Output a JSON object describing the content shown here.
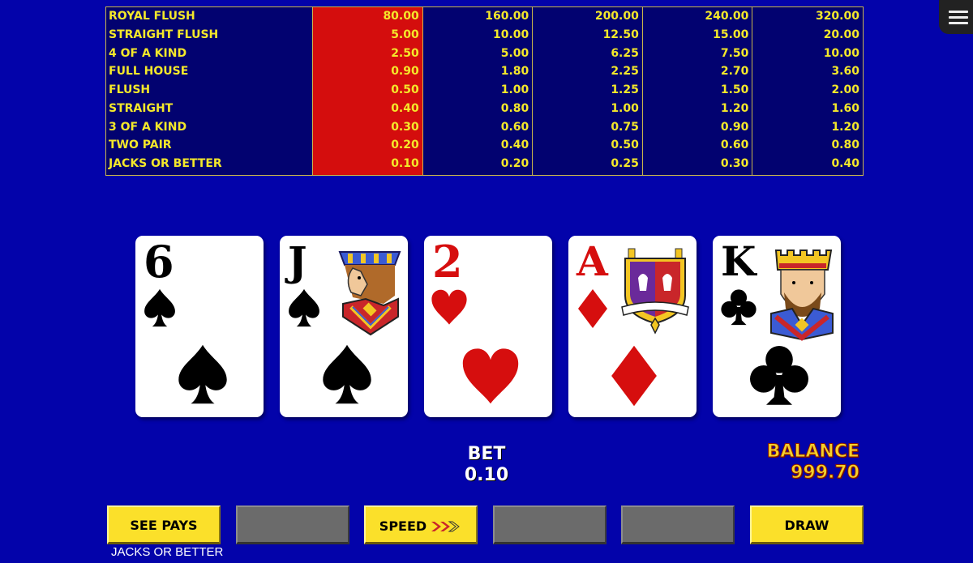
{
  "paytable": {
    "hands": [
      "ROYAL FLUSH",
      "STRAIGHT FLUSH",
      "4 OF A KIND",
      "FULL HOUSE",
      "FLUSH",
      "STRAIGHT",
      "3 OF A KIND",
      "TWO PAIR",
      "JACKS OR BETTER"
    ],
    "columns": [
      [
        "80.00",
        "5.00",
        "2.50",
        "0.90",
        "0.50",
        "0.40",
        "0.30",
        "0.20",
        "0.10"
      ],
      [
        "160.00",
        "10.00",
        "5.00",
        "1.80",
        "1.00",
        "0.80",
        "0.60",
        "0.40",
        "0.20"
      ],
      [
        "200.00",
        "12.50",
        "6.25",
        "2.25",
        "1.25",
        "1.00",
        "0.75",
        "0.50",
        "0.25"
      ],
      [
        "240.00",
        "15.00",
        "7.50",
        "2.70",
        "1.50",
        "1.20",
        "0.90",
        "0.60",
        "0.30"
      ],
      [
        "320.00",
        "20.00",
        "10.00",
        "3.60",
        "2.00",
        "1.60",
        "1.20",
        "0.80",
        "0.40"
      ]
    ],
    "active_column": 0,
    "colors": {
      "text": "#f4e82a",
      "active": "#d40d0d",
      "background": "#020270",
      "border": "#c9b64a"
    }
  },
  "cards": [
    {
      "rank": "6",
      "suit": "spade",
      "color": "black",
      "face": false
    },
    {
      "rank": "J",
      "suit": "spade",
      "color": "black",
      "face": true
    },
    {
      "rank": "2",
      "suit": "heart",
      "color": "red",
      "face": false
    },
    {
      "rank": "A",
      "suit": "diamond",
      "color": "red",
      "face": true
    },
    {
      "rank": "K",
      "suit": "club",
      "color": "black",
      "face": true
    }
  ],
  "bet": {
    "label": "BET",
    "value": "0.10"
  },
  "balance": {
    "label": "BALANCE",
    "value": "999.70"
  },
  "buttons": {
    "see_pays": "SEE PAYS",
    "speed": "SPEED",
    "draw": "DRAW"
  },
  "game_name": "JACKS OR BETTER",
  "icons": {
    "menu": "hamburger-menu-icon",
    "speed": "triple-chevron-icon"
  },
  "theme": {
    "background": "#0303aa",
    "button_yellow": "#fbe02a",
    "button_gray": "#6b6b6b"
  }
}
